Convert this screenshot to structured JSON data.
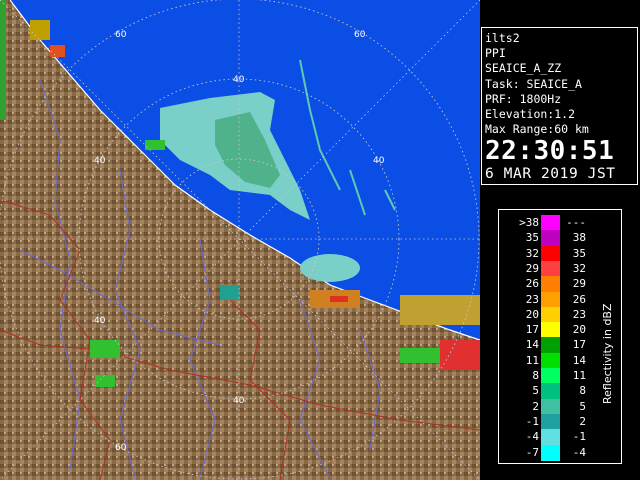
{
  "radar": {
    "range_labels": [
      "60",
      "60",
      "40",
      "40",
      "40",
      "40",
      "40",
      "60"
    ]
  },
  "info": {
    "station": "ilts2",
    "mode": "PPI",
    "product": "SEAICE_A_ZZ",
    "task": "Task: SEAICE_A",
    "prf": "PRF: 1800Hz",
    "elevation": "Elevation:1.2",
    "max_range": "Max Range:60 km",
    "time": "22:30:51",
    "date": " 6 MAR 2019 JST"
  },
  "legend": {
    "title": "Reflectivity in dBZ",
    "rows": [
      {
        "lo": ">38",
        "hi": "---",
        "color": "#ff00ff"
      },
      {
        "lo": "35",
        "hi": "38",
        "color": "#c000c0"
      },
      {
        "lo": "32",
        "hi": "35",
        "color": "#ff0000"
      },
      {
        "lo": "29",
        "hi": "32",
        "color": "#ff4040"
      },
      {
        "lo": "26",
        "hi": "29",
        "color": "#ff8000"
      },
      {
        "lo": "23",
        "hi": "26",
        "color": "#ffa000"
      },
      {
        "lo": "20",
        "hi": "23",
        "color": "#ffd000"
      },
      {
        "lo": "17",
        "hi": "20",
        "color": "#ffff00"
      },
      {
        "lo": "14",
        "hi": "17",
        "color": "#00a000"
      },
      {
        "lo": "11",
        "hi": "14",
        "color": "#00e000"
      },
      {
        "lo": "8",
        "hi": "11",
        "color": "#00ff60"
      },
      {
        "lo": "5",
        "hi": "8",
        "color": "#00c080"
      },
      {
        "lo": "2",
        "hi": "5",
        "color": "#40c0a0"
      },
      {
        "lo": "-1",
        "hi": "2",
        "color": "#20a0a0"
      },
      {
        "lo": "-4",
        "hi": "-1",
        "color": "#60e0e0"
      },
      {
        "lo": "-7",
        "hi": "-4",
        "color": "#00ffff"
      }
    ]
  }
}
